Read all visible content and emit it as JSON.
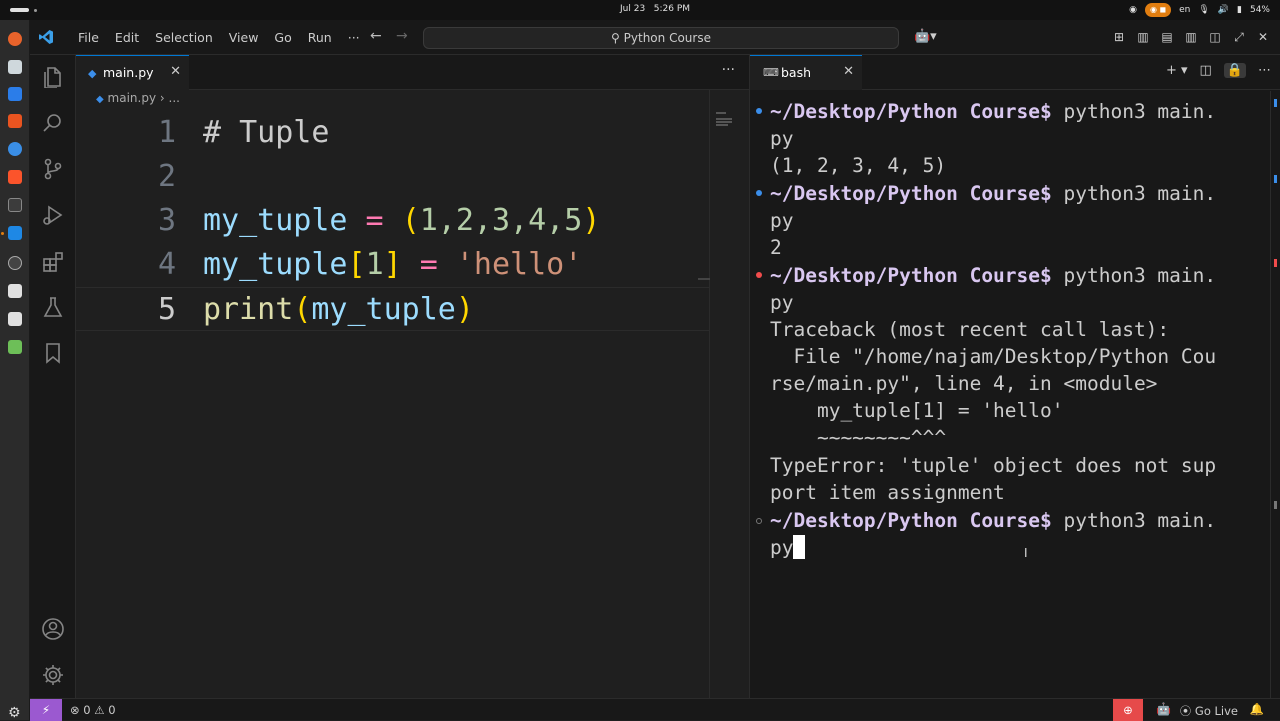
{
  "topbar": {
    "clock_date": "Jul 23",
    "clock_time": "5:26 PM",
    "language": "en",
    "battery": "54%"
  },
  "titlebar": {
    "menu": [
      "File",
      "Edit",
      "Selection",
      "View",
      "Go",
      "Run"
    ],
    "menu_more": "···",
    "search_text": "Python Course"
  },
  "editor": {
    "tab_label": "main.py",
    "breadcrumb_file": "main.py",
    "breadcrumb_more": "...",
    "more_actions": "···",
    "lines": [
      {
        "n": "1",
        "text": "# Tuple"
      },
      {
        "n": "2",
        "text": ""
      },
      {
        "n": "3",
        "var": "my_tuple",
        "op": " = ",
        "open": "(",
        "nums": "1,2,3,4,5",
        "close": ")"
      },
      {
        "n": "4",
        "var": "my_tuple",
        "idx_open": "[",
        "idx": "1",
        "idx_close": "]",
        "op": " = ",
        "str": "'hello'"
      },
      {
        "n": "5",
        "fn": "print",
        "open": "(",
        "arg": "my_tuple",
        "close": ")"
      }
    ]
  },
  "terminal": {
    "tab_label": "bash",
    "prompt": "~/Desktop/Python Course$",
    "rows": [
      "python3 main.",
      "py",
      "(1, 2, 3, 4, 5)",
      "python3 main.",
      "py",
      "2",
      "python3 main.",
      "py",
      "Traceback (most recent call last):",
      "  File \"/home/najam/Desktop/Python Cou",
      "rse/main.py\", line 4, in <module>",
      "    my_tuple[1] = 'hello'",
      "    ~~~~~~~~^^^",
      "TypeError: 'tuple' object does not sup",
      "port item assignment",
      "python3 main.",
      "py"
    ]
  },
  "statusbar": {
    "errors": "0",
    "warnings": "0",
    "golive": "Go Live"
  },
  "colors": {
    "accent": "#0078d4",
    "prompt": "#d9c7f0",
    "remote": "#9b59d0",
    "zoom_badge": "#e64a4a",
    "error_marker": "#f14c4c",
    "ok_marker": "#3b8eea"
  },
  "icons": {
    "activitybar": [
      "files-icon",
      "search-icon",
      "source-control-icon",
      "run-debug-icon",
      "extensions-icon",
      "testing-icon",
      "bookmark-icon",
      "account-icon",
      "settings-gear-icon"
    ]
  }
}
